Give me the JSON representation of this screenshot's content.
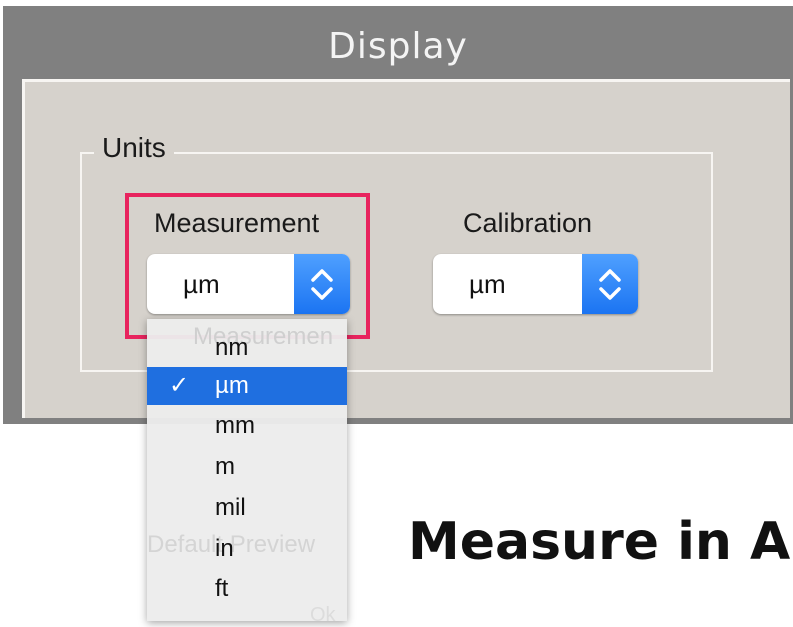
{
  "window": {
    "title": "Display"
  },
  "units_group": {
    "title": "Units",
    "measurement": {
      "label": "Measurement",
      "value": "µm"
    },
    "calibration": {
      "label": "Calibration",
      "value": "µm"
    }
  },
  "dropdown": {
    "ghost_text": "Measuremen",
    "items": [
      {
        "label": "nm",
        "checked": ""
      },
      {
        "label": "µm",
        "checked": "✓"
      },
      {
        "label": "mm",
        "checked": ""
      },
      {
        "label": "m",
        "checked": ""
      },
      {
        "label": "mil",
        "checked": ""
      },
      {
        "label": "in",
        "checked": ""
      },
      {
        "label": "ft",
        "checked": ""
      }
    ]
  },
  "background_text": {
    "ghost_default_preview": "Default Preview",
    "ghost_ok": "Ok"
  },
  "overlay": {
    "headline": "Measure in A"
  },
  "colors": {
    "accent": "#1f6fe0",
    "highlight": "#e8245e"
  }
}
